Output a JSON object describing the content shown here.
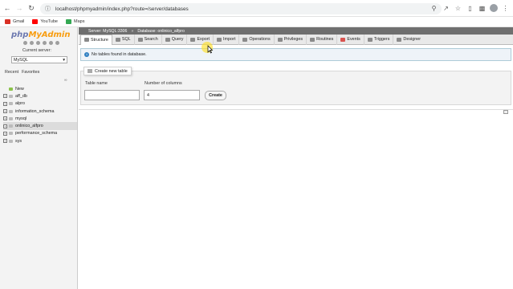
{
  "browser": {
    "url": "localhost/phpmyadmin/index.php?route=/server/databases",
    "bookmarks": [
      {
        "label": "Gmail",
        "icon": "gmail-icon",
        "color": "#d93025"
      },
      {
        "label": "YouTube",
        "icon": "youtube-icon",
        "color": "#ff0000"
      },
      {
        "label": "Maps",
        "icon": "maps-icon",
        "color": "#34a853"
      }
    ]
  },
  "sidebar": {
    "logo_php": "php",
    "logo_myadmin": "MyAdmin",
    "current_server_label": "Current server:",
    "server_value": "MySQL",
    "tabs": [
      "Recent",
      "Favorites"
    ],
    "tree": [
      {
        "label": "New"
      },
      {
        "label": "aff_db"
      },
      {
        "label": "alpro"
      },
      {
        "label": "information_schema"
      },
      {
        "label": "mysql"
      },
      {
        "label": "onlinico_alfpro"
      },
      {
        "label": "performance_schema"
      },
      {
        "label": "sys"
      }
    ]
  },
  "breadcrumb": {
    "server": "Server: MySQL:3306",
    "database": "Database: onlinico_alfpro"
  },
  "tabs": [
    {
      "label": "Structure",
      "icon": "structure-icon"
    },
    {
      "label": "SQL",
      "icon": "sql-icon"
    },
    {
      "label": "Search",
      "icon": "search-icon"
    },
    {
      "label": "Query",
      "icon": "query-icon"
    },
    {
      "label": "Export",
      "icon": "export-icon"
    },
    {
      "label": "Import",
      "icon": "import-icon"
    },
    {
      "label": "Operations",
      "icon": "wrench-icon"
    },
    {
      "label": "Privileges",
      "icon": "privileges-icon"
    },
    {
      "label": "Routines",
      "icon": "routines-icon"
    },
    {
      "label": "Events",
      "icon": "events-icon"
    },
    {
      "label": "Triggers",
      "icon": "triggers-icon"
    },
    {
      "label": "Designer",
      "icon": "designer-icon"
    }
  ],
  "notice": "No tables found in database.",
  "create_table": {
    "legend": "Create new table",
    "table_name_label": "Table name",
    "table_name_value": "",
    "columns_label": "Number of columns",
    "columns_value": "4",
    "create_button": "Create"
  }
}
